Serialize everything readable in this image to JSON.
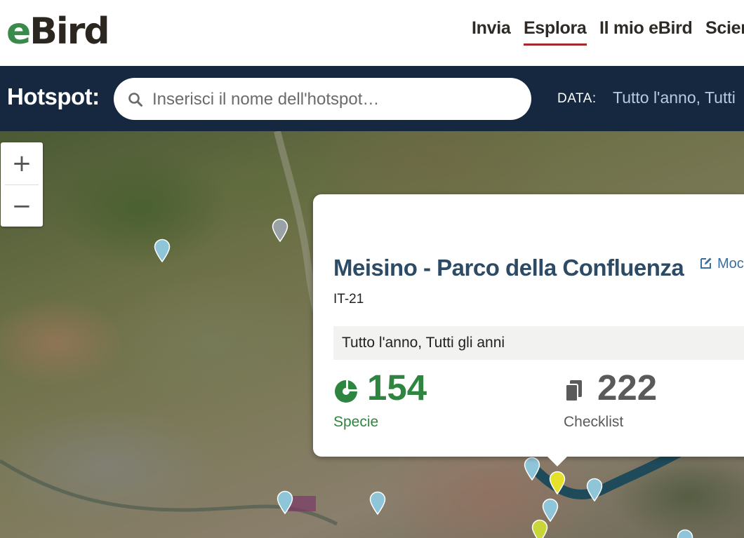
{
  "header": {
    "logo_e": "e",
    "logo_rest": "Bird",
    "nav": [
      {
        "label": "Invia",
        "active": false
      },
      {
        "label": "Esplora",
        "active": true
      },
      {
        "label": "Il mio eBird",
        "active": false
      },
      {
        "label": "Scien",
        "active": false
      }
    ]
  },
  "filter_bar": {
    "label": "Hotspot:",
    "search_placeholder": "Inserisci il nome dell'hotspot…",
    "date_label": "DATA:",
    "date_value": "Tutto l'anno,  Tutti"
  },
  "map": {
    "zoom_in": "+",
    "zoom_out": "−",
    "pins": [
      {
        "color": "#8fc5d8"
      },
      {
        "color": "#9aa2a6"
      },
      {
        "color": "#8fc5d8"
      },
      {
        "color": "#8fc5d8"
      },
      {
        "color": "#8fc5d8"
      },
      {
        "color": "#e6e02a"
      },
      {
        "color": "#8fc5d8"
      },
      {
        "color": "#8fc5d8"
      },
      {
        "color": "#c8d63a"
      },
      {
        "color": "#8fc5d8"
      }
    ]
  },
  "popup": {
    "title": "Meisino - Parco della Confluenza",
    "edit_label": "Moc",
    "region": "IT-21",
    "period": "Tutto l'anno, Tutti gli anni",
    "species_count": "154",
    "species_label": "Specie",
    "checklist_count": "222",
    "checklist_label": "Checklist"
  },
  "colors": {
    "brand_green": "#3a8a4b",
    "nav_active_underline": "#a8262c",
    "filter_bar_bg": "#15283f",
    "title_blue": "#2e4b66",
    "species_green": "#2e8540"
  }
}
